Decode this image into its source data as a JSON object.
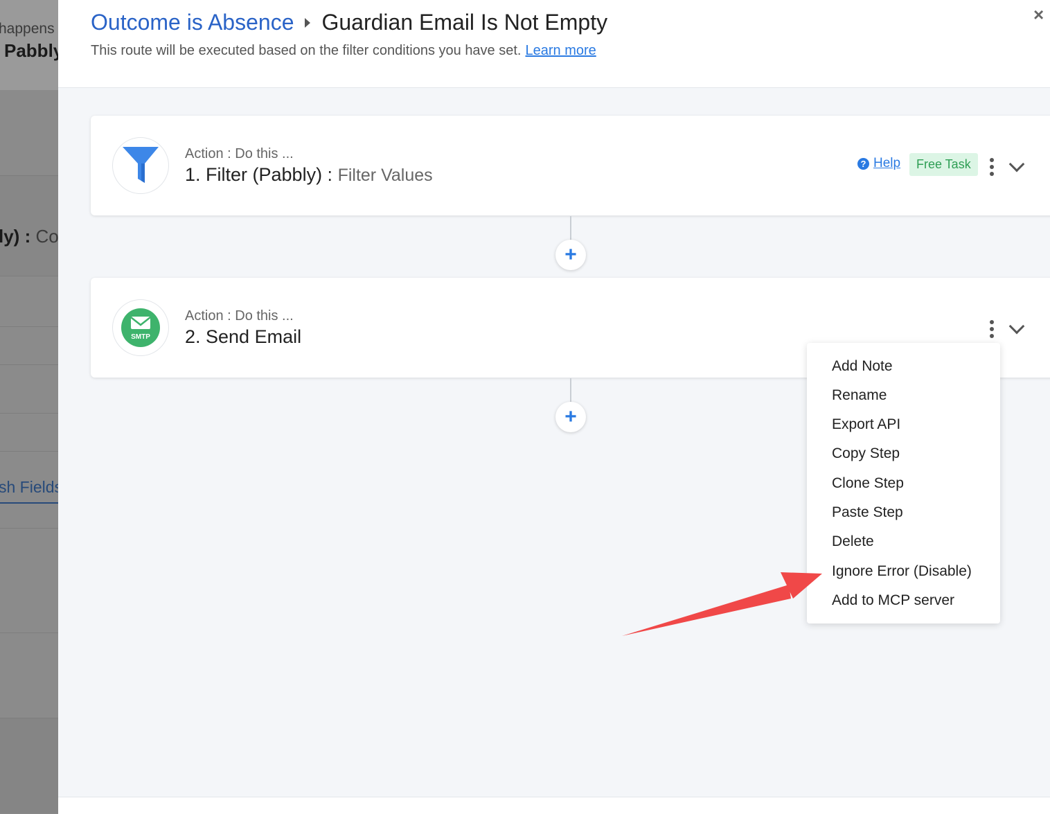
{
  "background_page": {
    "text_happens": "happens",
    "text_pabbly": "Pabbly",
    "text_ly": "ly) : ",
    "text_co": "Co",
    "text_fields": "sh Fields"
  },
  "header": {
    "route_link": "Outcome is Absence",
    "route_name": "Guardian Email Is Not Empty",
    "subtitle": "This route will be executed based on the filter conditions you have set.",
    "learn_more": "Learn more",
    "close": "×"
  },
  "steps": [
    {
      "label": "Action : Do this ...",
      "title": "1. Filter (Pabbly) : ",
      "subtitle": "Filter Values",
      "icon": "filter-funnel-icon",
      "help": "Help",
      "help_glyph": "?",
      "badge": "Free Task"
    },
    {
      "label": "Action : Do this ...",
      "title": "2. Send Email",
      "icon": "smtp-icon",
      "icon_text": "SMTP"
    }
  ],
  "add_step_glyph": "+",
  "context_menu": {
    "items": [
      "Add Note",
      "Rename",
      "Export API",
      "Copy Step",
      "Clone Step",
      "Paste Step",
      "Delete",
      "Ignore Error (Disable)",
      "Add to MCP server"
    ]
  },
  "colors": {
    "accent": "#2a7ae2",
    "route_link": "#2a63c7",
    "badge_bg": "#dcf5e5",
    "badge_text": "#2e9e54",
    "smtp_green": "#3eb36c",
    "annotation_arrow": "#f04848"
  }
}
